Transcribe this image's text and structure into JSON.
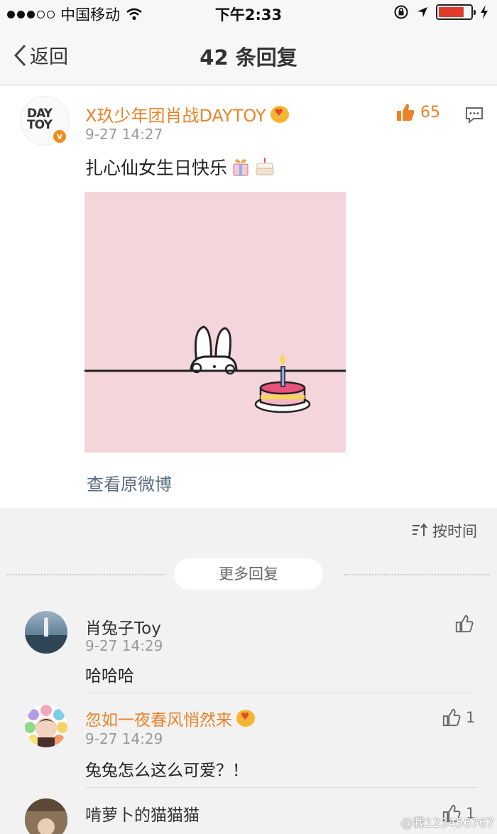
{
  "status_bar": {
    "carrier": "中国移动",
    "time": "下午2:33",
    "battery_level": 0.8,
    "battery_color": "#e23b2e"
  },
  "nav": {
    "back_label": "返回",
    "title": "42 条回复"
  },
  "post": {
    "author": "X玖少年团肖战DAYTOY",
    "avatar_text": "DAY TOY",
    "time": "9-27 14:27",
    "likes": "65",
    "text": "扎心仙女生日快乐",
    "view_original": "查看原微博",
    "name_color": "#e8832a"
  },
  "sort": {
    "label": "按时间"
  },
  "more_replies": {
    "label": "更多回复"
  },
  "replies": [
    {
      "name": "肖兔子Toy",
      "time": "9-27 14:29",
      "text": "哈哈哈",
      "likes": "",
      "name_color": "#333333"
    },
    {
      "name": "忽如一夜春风悄然来",
      "time": "9-27 14:29",
      "text": "兔兔怎么这么可爱？！",
      "likes": "1",
      "name_color": "#e8832a"
    },
    {
      "name": "啃萝卜的猫猫猫",
      "time": "",
      "text": "",
      "likes": "1",
      "name_color": "#333333"
    }
  ],
  "watermark": "@我123456767"
}
